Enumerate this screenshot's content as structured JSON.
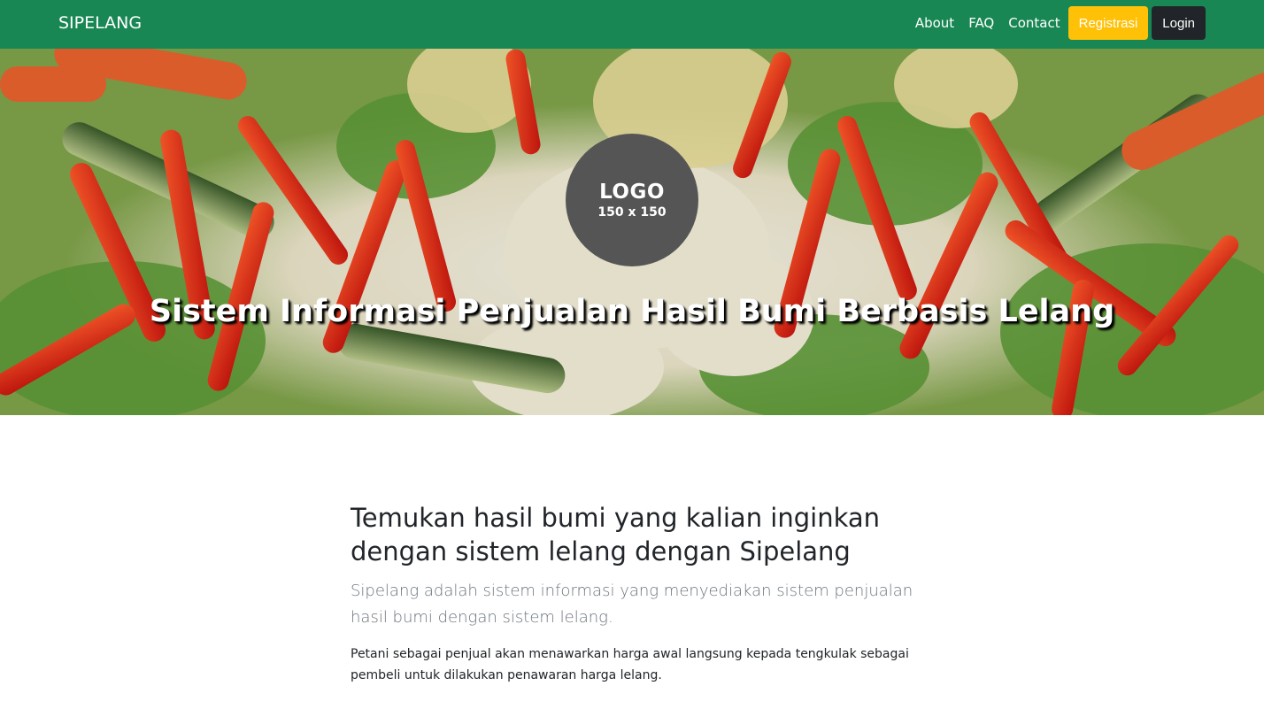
{
  "navbar": {
    "brand": "SIPELANG",
    "links": [
      "About",
      "FAQ",
      "Contact"
    ],
    "register_label": "Registrasi",
    "login_label": "Login",
    "bg_color": "#198754"
  },
  "hero": {
    "logo_text": "LOGO",
    "logo_size": "150 x 150",
    "title": "Sistem Informasi Penjualan Hasil Bumi Berbasis Lelang"
  },
  "content": {
    "headline": "Temukan hasil bumi yang kalian inginkan dengan sistem lelang dengan Sipelang",
    "lead": "Sipelang adalah sistem informasi yang menyediakan sistem penjualan hasil bumi dengan sistem lelang.",
    "body": "Petani sebagai penjual akan menawarkan harga awal langsung kepada tengkulak sebagai pembeli untuk dilakukan penawaran harga lelang."
  },
  "colors": {
    "accent_green": "#198754",
    "warning": "#ffc107",
    "dark": "#212529",
    "muted": "#6c757d"
  }
}
